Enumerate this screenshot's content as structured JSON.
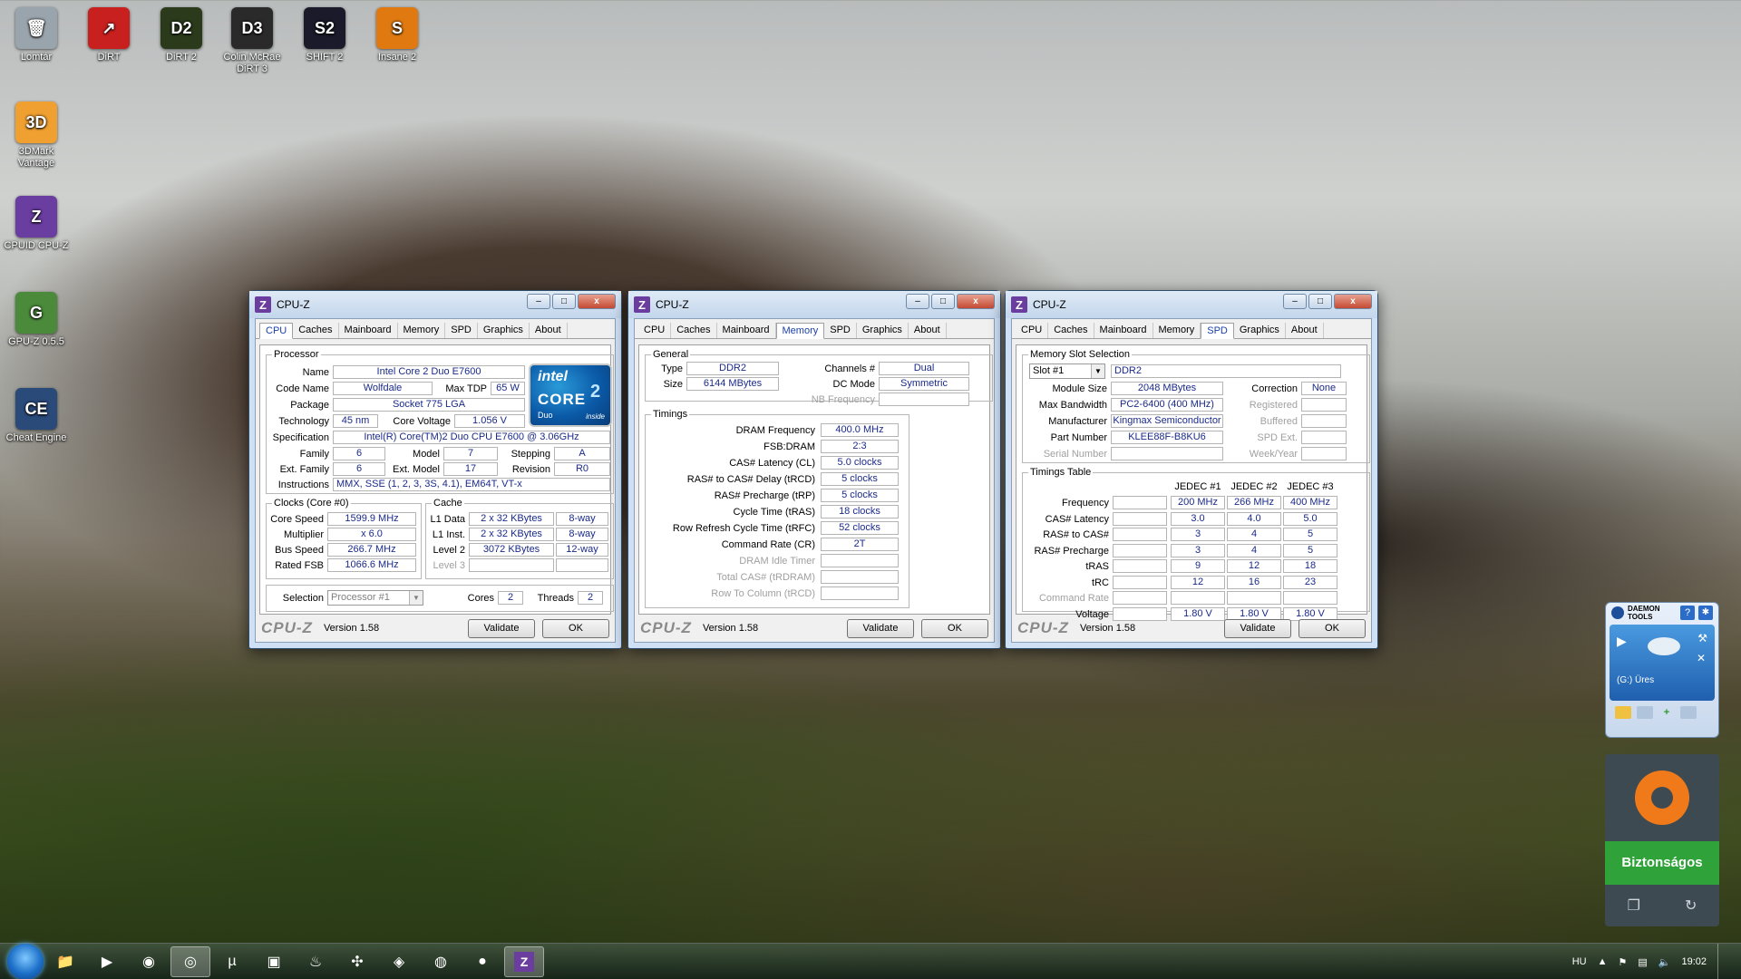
{
  "desktop": {
    "icons": [
      {
        "label": "Lomtár",
        "glyph": "🗑"
      },
      {
        "label": "DiRT",
        "glyph": "↗"
      },
      {
        "label": "DiRT 2",
        "glyph": "D2"
      },
      {
        "label": "Colin McRae DiRT 3",
        "glyph": "D3"
      },
      {
        "label": "SHIFT 2",
        "glyph": "S2"
      },
      {
        "label": "Insane 2",
        "glyph": "S"
      },
      {
        "label": "3DMark Vantage",
        "glyph": "3D"
      },
      {
        "label": "CPUID CPU-Z",
        "glyph": "Z"
      },
      {
        "label": "GPU-Z 0.5.5",
        "glyph": "G"
      },
      {
        "label": "Cheat Engine",
        "glyph": "CE"
      }
    ]
  },
  "common": {
    "title": "CPU-Z",
    "tabs": [
      "CPU",
      "Caches",
      "Mainboard",
      "Memory",
      "SPD",
      "Graphics",
      "About"
    ],
    "brand": "CPU-Z",
    "version": "Version 1.58",
    "validate": "Validate",
    "ok": "OK",
    "minimize": "–",
    "maximize": "□",
    "close": "x"
  },
  "cpu": {
    "processor_legend": "Processor",
    "name_label": "Name",
    "name": "Intel Core 2 Duo E7600",
    "codename_label": "Code Name",
    "codename": "Wolfdale",
    "maxtdp_label": "Max TDP",
    "maxtdp": "65 W",
    "package_label": "Package",
    "package": "Socket 775 LGA",
    "technology_label": "Technology",
    "technology": "45 nm",
    "corevoltage_label": "Core Voltage",
    "corevoltage": "1.056 V",
    "spec_label": "Specification",
    "spec": "Intel(R) Core(TM)2 Duo CPU     E7600  @ 3.06GHz",
    "family_label": "Family",
    "family": "6",
    "model_label": "Model",
    "model": "7",
    "stepping_label": "Stepping",
    "stepping": "A",
    "extfamily_label": "Ext. Family",
    "extfamily": "6",
    "extmodel_label": "Ext. Model",
    "extmodel": "17",
    "revision_label": "Revision",
    "revision": "R0",
    "instructions_label": "Instructions",
    "instructions": "MMX, SSE (1, 2, 3, 3S, 4.1), EM64T, VT-x",
    "clocks_legend": "Clocks (Core #0)",
    "corespeed_label": "Core Speed",
    "corespeed": "1599.9 MHz",
    "multiplier_label": "Multiplier",
    "multiplier": "x 6.0",
    "busspeed_label": "Bus Speed",
    "busspeed": "266.7 MHz",
    "ratedfsb_label": "Rated FSB",
    "ratedfsb": "1066.6 MHz",
    "cache_legend": "Cache",
    "l1data_label": "L1 Data",
    "l1data": "2 x 32 KBytes",
    "l1data_way": "8-way",
    "l1inst_label": "L1 Inst.",
    "l1inst": "2 x 32 KBytes",
    "l1inst_way": "8-way",
    "level2_label": "Level 2",
    "level2": "3072 KBytes",
    "level2_way": "12-way",
    "level3_label": "Level 3",
    "selection_label": "Selection",
    "selection": "Processor #1",
    "cores_label": "Cores",
    "cores": "2",
    "threads_label": "Threads",
    "threads": "2",
    "intel_logo": {
      "brand": "intel",
      "line1": "CORE",
      "line2": "2",
      "sub": "Duo",
      "inside": "inside"
    }
  },
  "memory": {
    "general_legend": "General",
    "type_label": "Type",
    "type": "DDR2",
    "size_label": "Size",
    "size": "6144 MBytes",
    "channels_label": "Channels #",
    "channels": "Dual",
    "dcmode_label": "DC Mode",
    "dcmode": "Symmetric",
    "nbfreq_label": "NB Frequency",
    "timings_legend": "Timings",
    "dramfreq_label": "DRAM Frequency",
    "dramfreq": "400.0 MHz",
    "fsbdram_label": "FSB:DRAM",
    "fsbdram": "2:3",
    "cl_label": "CAS# Latency (CL)",
    "cl": "5.0 clocks",
    "trcd_label": "RAS# to CAS# Delay (tRCD)",
    "trcd": "5 clocks",
    "trp_label": "RAS# Precharge (tRP)",
    "trp": "5 clocks",
    "tras_label": "Cycle Time (tRAS)",
    "tras": "18 clocks",
    "trfc_label": "Row Refresh Cycle Time (tRFC)",
    "trfc": "52 clocks",
    "cr_label": "Command Rate (CR)",
    "cr": "2T",
    "idle_label": "DRAM Idle Timer",
    "trdram_label": "Total CAS# (tRDRAM)",
    "trcd2_label": "Row To Column (tRCD)"
  },
  "spd": {
    "slot_legend": "Memory Slot Selection",
    "slot": "Slot #1",
    "slot_type": "DDR2",
    "modulesize_label": "Module Size",
    "modulesize": "2048 MBytes",
    "maxbw_label": "Max Bandwidth",
    "maxbw": "PC2-6400 (400 MHz)",
    "manufacturer_label": "Manufacturer",
    "manufacturer": "Kingmax Semiconductor",
    "partnumber_label": "Part Number",
    "partnumber": "KLEE88F-B8KU6",
    "serial_label": "Serial Number",
    "correction_label": "Correction",
    "correction": "None",
    "registered_label": "Registered",
    "buffered_label": "Buffered",
    "spdext_label": "SPD Ext.",
    "weekyear_label": "Week/Year",
    "timings_legend": "Timings Table",
    "jedec_headers": [
      "JEDEC #1",
      "JEDEC #2",
      "JEDEC #3"
    ],
    "rows": [
      {
        "label": "Frequency",
        "values": [
          "200 MHz",
          "266 MHz",
          "400 MHz"
        ],
        "dim": false
      },
      {
        "label": "CAS# Latency",
        "values": [
          "3.0",
          "4.0",
          "5.0"
        ],
        "dim": false
      },
      {
        "label": "RAS# to CAS#",
        "values": [
          "3",
          "4",
          "5"
        ],
        "dim": false
      },
      {
        "label": "RAS# Precharge",
        "values": [
          "3",
          "4",
          "5"
        ],
        "dim": false
      },
      {
        "label": "tRAS",
        "values": [
          "9",
          "12",
          "18"
        ],
        "dim": false
      },
      {
        "label": "tRC",
        "values": [
          "12",
          "16",
          "23"
        ],
        "dim": false
      },
      {
        "label": "Command Rate",
        "values": [
          "",
          "",
          ""
        ],
        "dim": true
      },
      {
        "label": "Voltage",
        "values": [
          "1.80 V",
          "1.80 V",
          "1.80 V"
        ],
        "dim": false
      }
    ]
  },
  "gadgets": {
    "daemon_title": "DAEMON TOOLS",
    "daemon_drive": "(G:) Üres",
    "avast_status": "Biztonságos"
  },
  "taskbar": {
    "language": "HU",
    "time": "19:02"
  },
  "colors": {
    "accent": "#1a3fa8",
    "value_text": "#1a2a8a",
    "avast_green": "#2fa33a",
    "avast_orange": "#f07a1a"
  }
}
